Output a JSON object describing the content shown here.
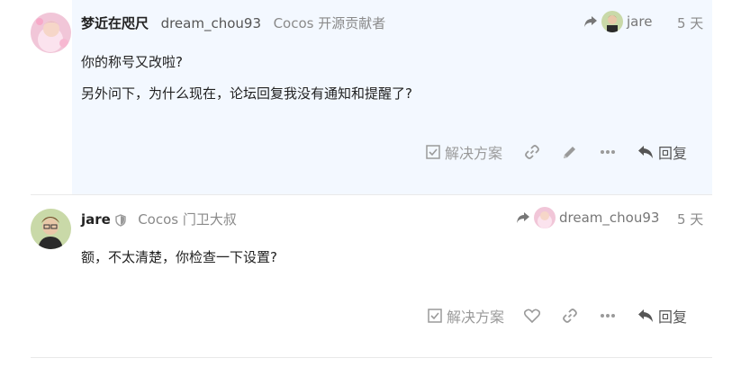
{
  "posts": [
    {
      "display_name": "梦近在咫尺",
      "username": "dream_chou93",
      "user_title": "Cocos 开源贡献者",
      "reply_to_user": "jare",
      "age": "5 天",
      "paragraphs": [
        "你的称号又改啦?",
        "另外问下，为什么现在，论坛回复我没有通知和提醒了?"
      ],
      "actions": {
        "solution_label": "解决方案",
        "reply_label": "回复"
      }
    },
    {
      "username": "jare",
      "user_title": "Cocos 门卫大叔",
      "reply_to_user": "dream_chou93",
      "age": "5 天",
      "paragraphs": [
        "额，不太清楚，你检查一下设置?"
      ],
      "actions": {
        "solution_label": "解决方案",
        "reply_label": "回复"
      }
    }
  ]
}
